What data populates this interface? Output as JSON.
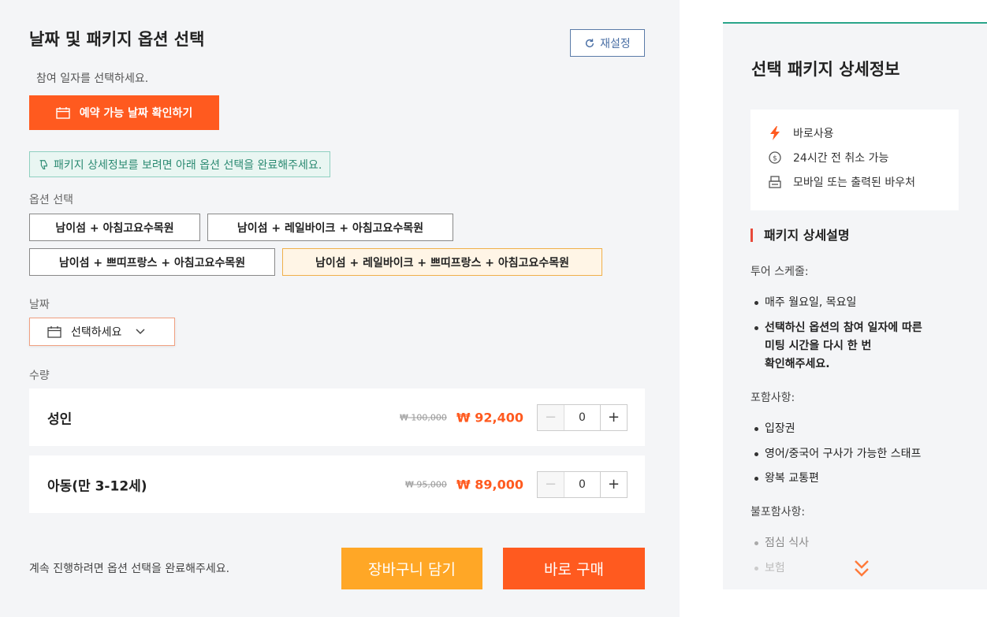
{
  "left": {
    "title": "날짜 및 패키지 옵션 선택",
    "reset_label": "재설정",
    "subtitle": "참여 일자를 선택하세요.",
    "check_date_label": "예약 가능 날짜 확인하기",
    "tip": "패키지 상세정보를 보려면 아래 옵션 선택을 완료해주세요.",
    "option_label": "옵션 선택",
    "options": [
      "남이섬 + 아침고요수목원",
      "남이섬 + 레일바이크 + 아침고요수목원",
      "남이섬 + 쁘띠프랑스 + 아침고요수목원",
      "남이섬 + 레일바이크 + 쁘띠프랑스 + 아침고요수목원"
    ],
    "selected_option_index": 3,
    "date_label": "날짜",
    "date_placeholder": "선택하세요",
    "qty_label": "수량",
    "qty_rows": [
      {
        "name": "성인",
        "old_price": "₩ 100,000",
        "price": "₩ 92,400",
        "qty": "0",
        "minus": "−",
        "plus": "+"
      },
      {
        "name": "아동(만 3-12세)",
        "old_price": "₩ 95,000",
        "price": "₩ 89,000",
        "qty": "0",
        "minus": "−",
        "plus": "+"
      }
    ],
    "footer_note": "계속 진행하려면 옵션 선택을 완료해주세요.",
    "cart_label": "장바구니 담기",
    "buy_label": "바로 구매"
  },
  "right": {
    "title": "선택 패키지 상세정보",
    "features": [
      {
        "icon": "lightning-icon",
        "text": "바로사용"
      },
      {
        "icon": "refund-icon",
        "text": "24시간 전 취소 가능"
      },
      {
        "icon": "printer-icon",
        "text": "모바일 또는 출력된 바우처"
      }
    ],
    "section_title": "패키지 상세설명",
    "schedule_label": "투어 스케줄:",
    "schedule_items": [
      "매주 월요일, 목요일"
    ],
    "schedule_note_lines": [
      "선택하신 옵션의 참여 일자에 따른",
      "미팅 시간을 다시 한 번",
      "확인해주세요."
    ],
    "included_label": "포함사항:",
    "included_items": [
      "입장권",
      "영어/중국어 구사가 가능한 스태프",
      "왕복 교통편"
    ],
    "excluded_label": "불포함사항:",
    "excluded_items": [
      "점심 식사",
      "보험"
    ]
  },
  "colors": {
    "accent": "#ff5a1f",
    "cart": "#ffa726",
    "teal": "#2aa58a",
    "section_bar": "#e84a3a"
  }
}
